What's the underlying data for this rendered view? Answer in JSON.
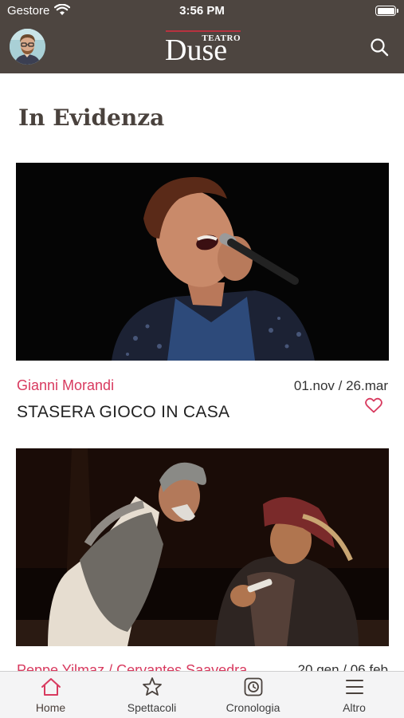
{
  "status_bar": {
    "carrier": "Gestore",
    "time": "3:56 PM"
  },
  "header": {
    "logo_small": "TEATRO",
    "logo_big": "Duse"
  },
  "section": {
    "title": "In Evidenza"
  },
  "cards": [
    {
      "artist": "Gianni Morandi",
      "dates": "01.nov / 26.mar",
      "title": "STASERA GIOCO IN CASA",
      "favorite": false
    },
    {
      "artist": "Peppe Yilmaz / Cervantes Saavedra",
      "dates": "20.gen / 06.feb"
    }
  ],
  "tabbar": {
    "home": "Home",
    "spettacoli": "Spettacoli",
    "cronologia": "Cronologia",
    "altro": "Altro"
  },
  "colors": {
    "header_bg": "#4d4540",
    "accent": "#d83a5f",
    "tabbar_bg": "#f4f4f5"
  }
}
